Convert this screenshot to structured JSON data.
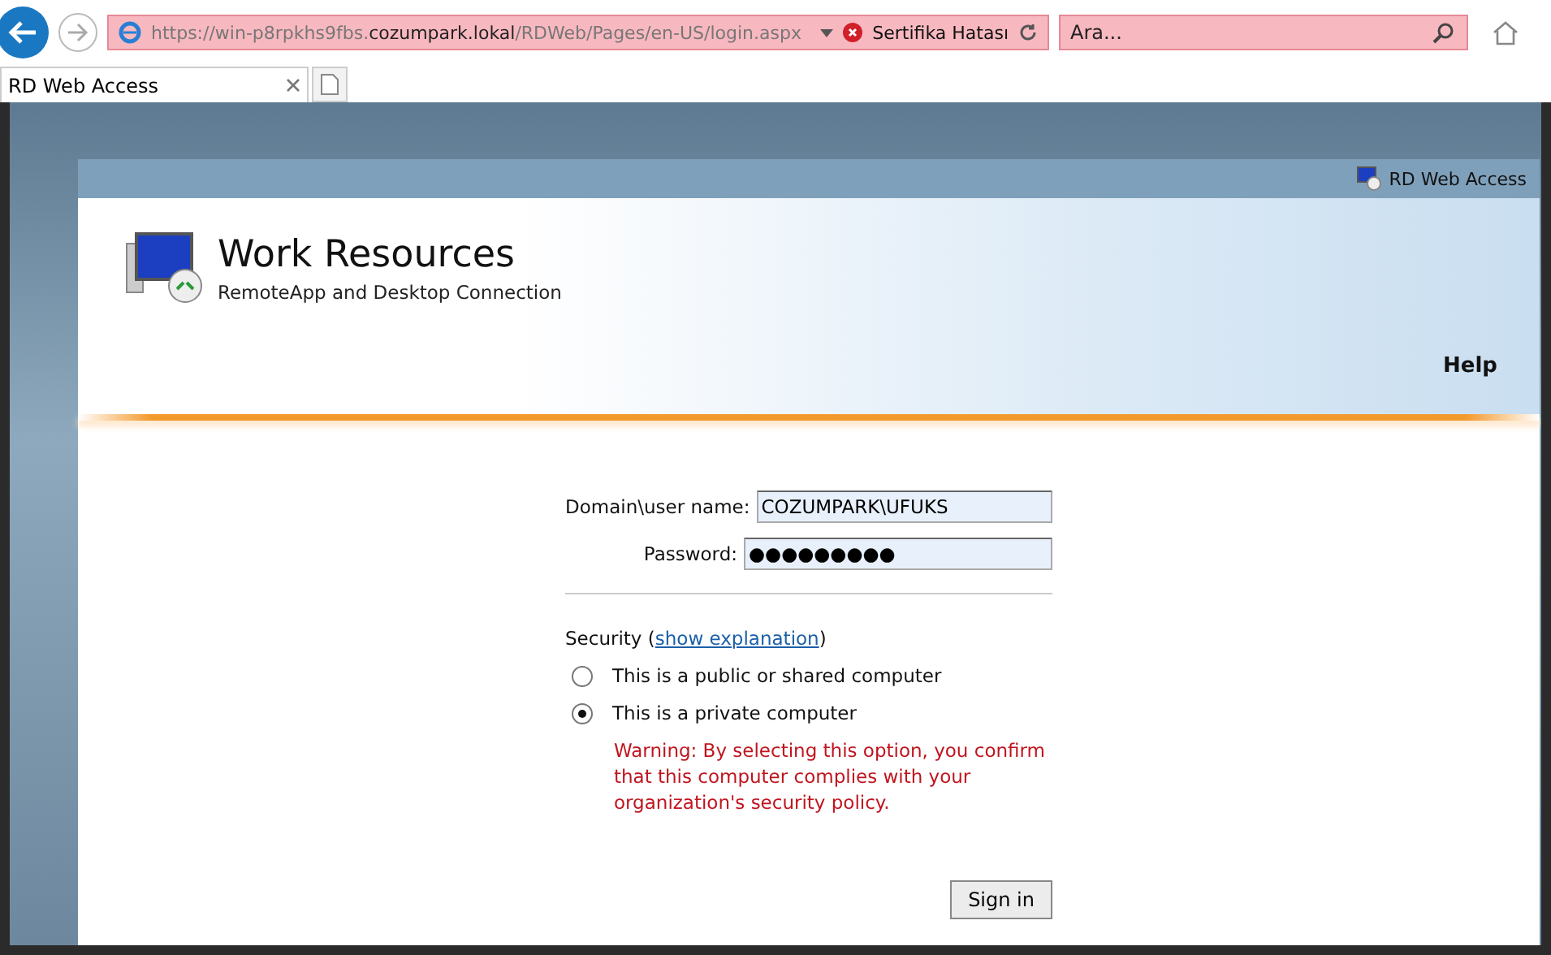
{
  "browser": {
    "address": "https://win-p8rpkhs9fbs.**cozumpark.lokal**/RDWeb/Pages/en-US/login.aspx",
    "certificate_error": "Sertifika Hatası",
    "search": {
      "placeholder": "Ara..."
    },
    "tabs": [
      {
        "label": "RD Web Access",
        "selected": true
      }
    ]
  },
  "page": {
    "top_bar_label": "RD Web Access",
    "title": "Work Resources",
    "subtitle": "RemoteApp and Desktop Connection",
    "help": "Help",
    "fields": [
      {
        "label": "Domain\\user name:",
        "value": "COZUMPARK\\UFUKS"
      },
      {
        "label": "Password:",
        "value": "●●●●●●●●●"
      }
    ],
    "security": {
      "label": "Security (",
      "link": "show explanation",
      "label_end": ")"
    },
    "options": [
      {
        "label": "This is a public or shared computer",
        "selected": false
      },
      {
        "label": "This is a private computer",
        "selected": true
      }
    ],
    "warning": "Warning: By selecting this option, you confirm that this computer complies with your organization's security policy.",
    "sign_in": "Sign in"
  }
}
